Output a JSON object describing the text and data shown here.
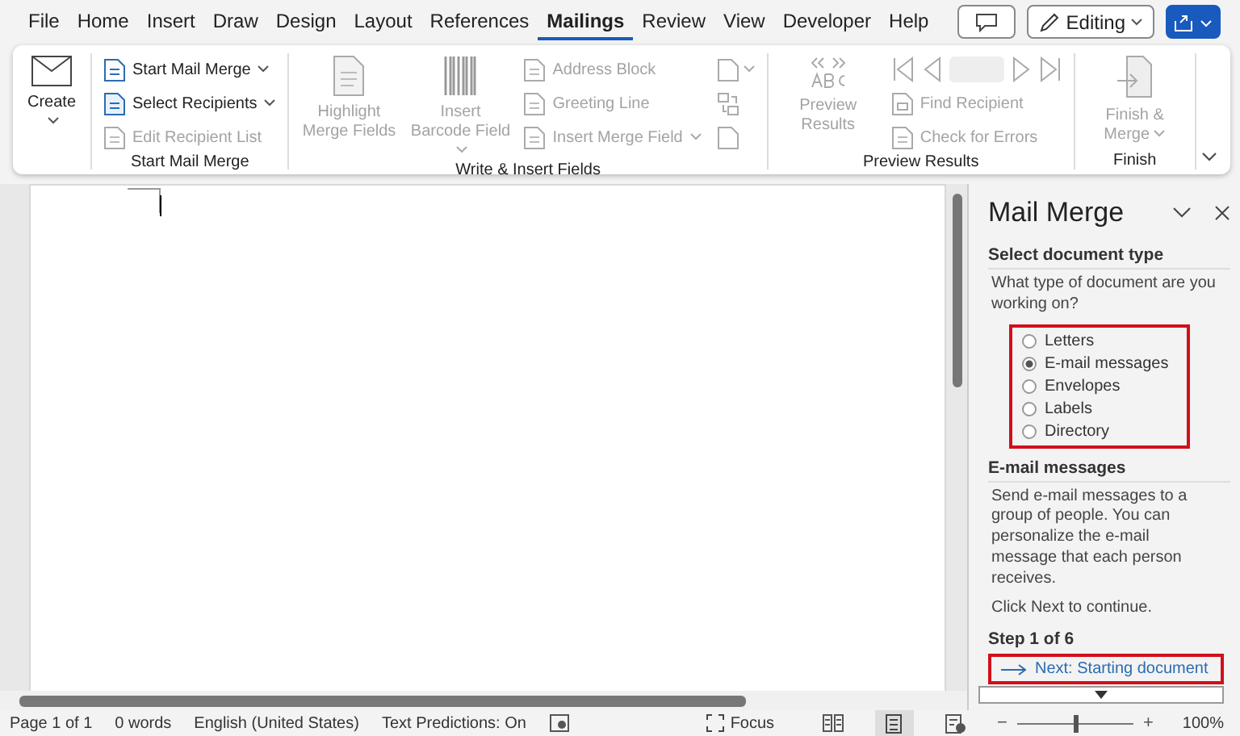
{
  "menu_tabs": [
    {
      "label": "File",
      "selected": false
    },
    {
      "label": "Home",
      "selected": false
    },
    {
      "label": "Insert",
      "selected": false
    },
    {
      "label": "Draw",
      "selected": false
    },
    {
      "label": "Design",
      "selected": false
    },
    {
      "label": "Layout",
      "selected": false
    },
    {
      "label": "References",
      "selected": false
    },
    {
      "label": "Mailings",
      "selected": true
    },
    {
      "label": "Review",
      "selected": false
    },
    {
      "label": "View",
      "selected": false
    },
    {
      "label": "Developer",
      "selected": false
    },
    {
      "label": "Help",
      "selected": false
    }
  ],
  "editing_button": {
    "label": "Editing"
  },
  "ribbon_groups": [
    {
      "columns": [
        [
          {
            "kind": "large",
            "label": "Create",
            "disabled": false,
            "dropdown": true
          }
        ]
      ]
    },
    {
      "label": "Start Mail Merge",
      "columns": [
        [
          {
            "kind": "small",
            "label": "Start Mail Merge",
            "disabled": false,
            "dropdown": true
          },
          {
            "kind": "small",
            "label": "Select Recipients",
            "disabled": false,
            "dropdown": true
          },
          {
            "kind": "small",
            "label": "Edit Recipient List",
            "disabled": true,
            "dropdown": false
          }
        ]
      ]
    },
    {
      "label": "Write & Insert Fields",
      "columns": [
        [
          {
            "kind": "large",
            "label": "Highlight Merge Fields",
            "disabled": true,
            "dropdown": false
          }
        ],
        [
          {
            "kind": "large",
            "label": "Insert Barcode Field",
            "disabled": true,
            "dropdown": true
          }
        ],
        [
          {
            "kind": "small",
            "label": "Address Block",
            "disabled": true,
            "dropdown": false
          },
          {
            "kind": "small",
            "label": "Greeting Line",
            "disabled": true,
            "dropdown": false
          },
          {
            "kind": "small",
            "label": "Insert Merge Field",
            "disabled": true,
            "dropdown": true
          }
        ],
        [
          {
            "kind": "icon",
            "disabled": true,
            "dropdown": true
          },
          {
            "kind": "icon",
            "disabled": true,
            "dropdown": false
          },
          {
            "kind": "icon",
            "disabled": true,
            "dropdown": false
          }
        ]
      ]
    },
    {
      "label": "Preview Results",
      "columns": [
        [
          {
            "kind": "large",
            "label": "Preview Results",
            "disabled": true,
            "dropdown": false
          }
        ],
        [
          {
            "kind": "nav",
            "disabled": true
          },
          {
            "kind": "small",
            "label": "Find Recipient",
            "disabled": true,
            "dropdown": false
          },
          {
            "kind": "small",
            "label": "Check for Errors",
            "disabled": true,
            "dropdown": false
          }
        ]
      ]
    },
    {
      "label": "Finish",
      "columns": [
        [
          {
            "kind": "large",
            "label": "Finish & Merge",
            "disabled": true,
            "dropdown": true
          }
        ]
      ]
    }
  ],
  "task_pane": {
    "title": "Mail Merge",
    "sections": [
      {
        "heading": "Select document type",
        "paragraphs": [
          "What type of document are you working on?"
        ],
        "options": [
          {
            "label": "Letters",
            "selected": false
          },
          {
            "label": "E-mail messages",
            "selected": true
          },
          {
            "label": "Envelopes",
            "selected": false
          },
          {
            "label": "Labels",
            "selected": false
          },
          {
            "label": "Directory",
            "selected": false
          }
        ]
      },
      {
        "heading": "E-mail messages",
        "paragraphs": [
          "Send e-mail messages to a group of people. You can personalize the e-mail message that each person receives.",
          "Click Next to continue."
        ]
      }
    ],
    "step": "Step 1 of 6",
    "next_link": "Next: Starting document"
  },
  "status_bar": {
    "page": "Page 1 of 1",
    "words": "0 words",
    "language": "English (United States)",
    "predictions": "Text Predictions: On",
    "focus": "Focus",
    "views": [
      {
        "kind": "read",
        "selected": false
      },
      {
        "kind": "print",
        "selected": true
      },
      {
        "kind": "web",
        "selected": false
      }
    ],
    "zoom": {
      "zoom_out": "−",
      "zoom_in": "+",
      "level": 0.5,
      "reading": "100%"
    }
  }
}
